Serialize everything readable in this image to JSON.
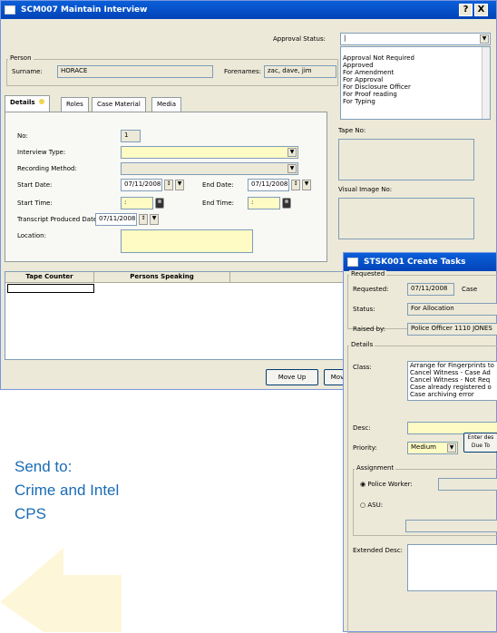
{
  "win1": {
    "title": "SCM007 Maintain Interview",
    "help_label": "?",
    "close_label": "X",
    "approval_status_label": "Approval Status:",
    "approval_options": [
      "Approval Not Required",
      "Approved",
      "For Amendment",
      "For Approval",
      "For Disclosure Officer",
      "For Proof reading",
      "For Typing"
    ],
    "person_group": "Person",
    "surname_label": "Surname:",
    "surname_value": "HORACE",
    "forenames_label": "Forenames:",
    "forenames_value": "zac, dave, jim",
    "tabs": [
      "Details",
      "Roles",
      "Case Material",
      "Media"
    ],
    "no_label": "No:",
    "no_value": "1",
    "interview_type_label": "Interview Type:",
    "recording_method_label": "Recording Method:",
    "start_date_label": "Start Date:",
    "start_date_value": "07/11/2008",
    "end_date_label": "End Date:",
    "end_date_value": "07/11/2008",
    "start_time_label": "Start Time:",
    "start_time_value": ":",
    "end_time_label": "End Time:",
    "end_time_value": ":",
    "transcript_label": "Transcript Produced Date:",
    "transcript_value": "07/11/2008",
    "location_label": "Location:",
    "tape_no_label": "Tape No:",
    "visual_image_label": "Visual Image No:",
    "grid_headers": [
      "Tape Counter",
      "Persons Speaking"
    ],
    "move_up_label": "Move Up",
    "move_down_label": "Mov"
  },
  "win2": {
    "title": "STSK001 Create Tasks",
    "requested_group": "Requested",
    "requested_label": "Requested:",
    "requested_value": "07/11/2008",
    "case_label": "Case",
    "status_label": "Status:",
    "status_value": "For Allocation",
    "raised_by_label": "Raised by:",
    "raised_by_value": "Police Officer 1110 JONES",
    "details_group": "Details",
    "class_label": "Class:",
    "class_options": [
      "Arrange for Fingerprints to",
      "Cancel Witness - Case Ad",
      "Cancel Witness - Not Req",
      "Case already registered o",
      "Case archiving error"
    ],
    "desc_label": "Desc:",
    "priority_label": "Priority:",
    "priority_value": "Medium",
    "enter_desc_label": "Enter des",
    "due_to_label": "Due To",
    "assignment_group": "Assignment",
    "police_worker_label": "Police Worker:",
    "asu_label": "ASU:",
    "extended_desc_label": "Extended Desc:"
  },
  "sendto": {
    "line1": "Send to:",
    "line2": "Crime and Intel",
    "line3": "CPS"
  },
  "colors": {
    "accent_blue": "#1a6bb5",
    "arrow": "#fdf6d8",
    "titlebar": "#0a5fd8",
    "field_yellow": "#fffbc4"
  }
}
